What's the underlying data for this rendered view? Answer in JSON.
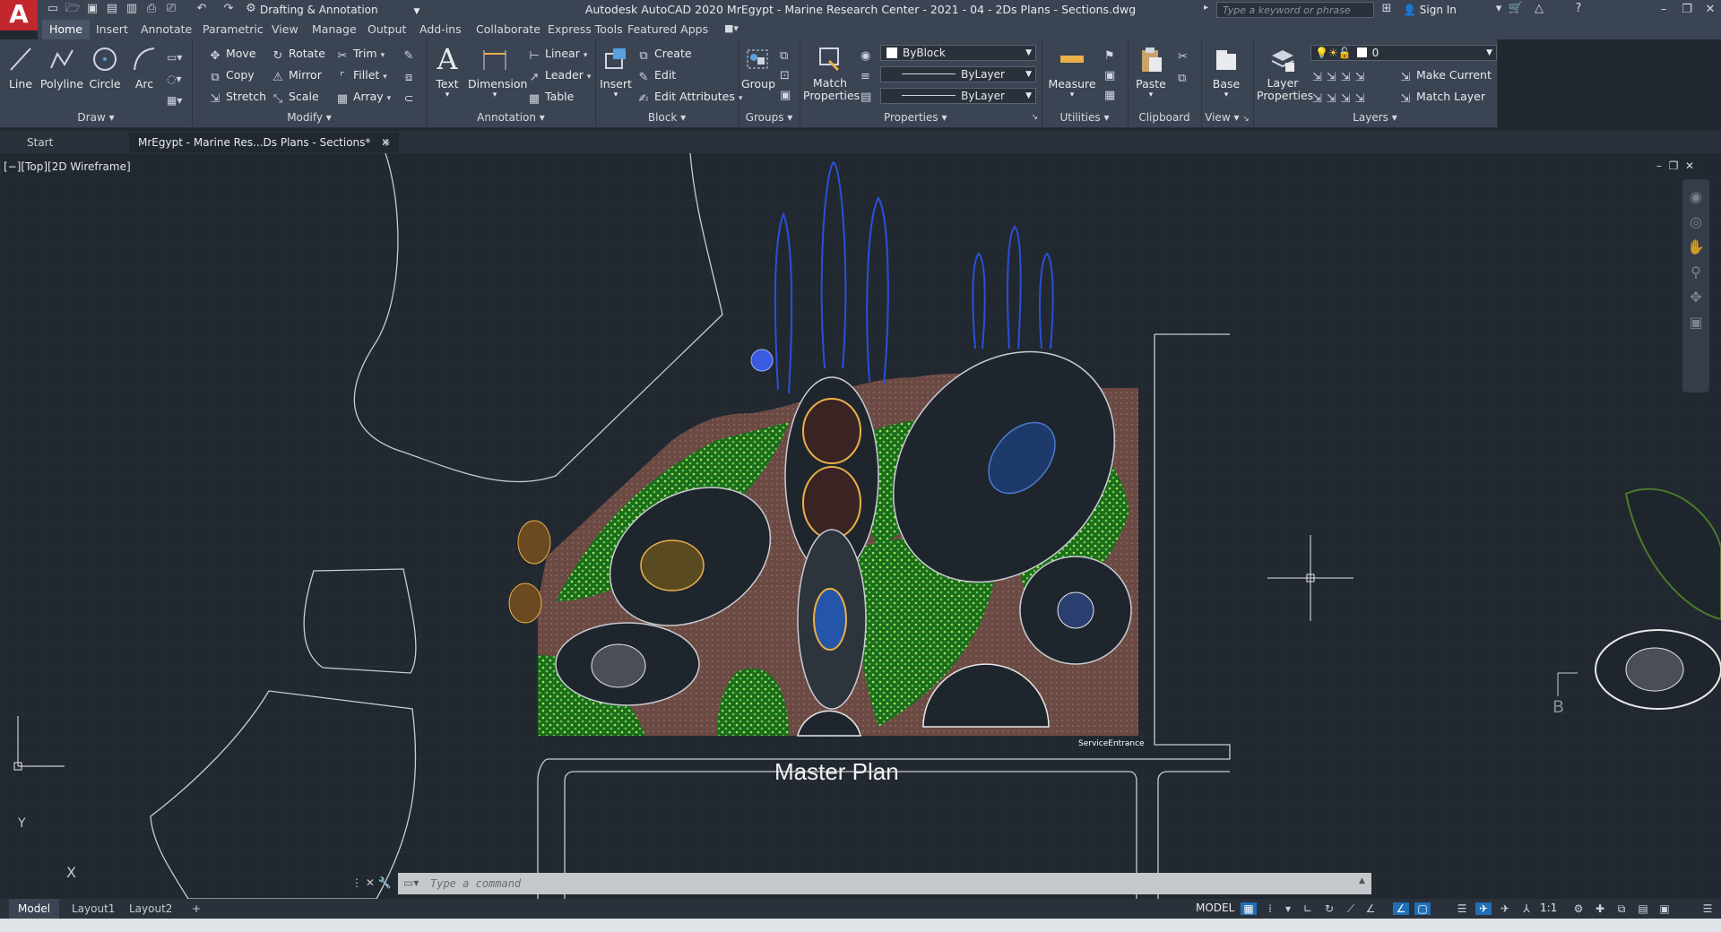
{
  "titlebar": {
    "app_letter": "A",
    "workspace": "Drafting & Annotation",
    "title": "Autodesk AutoCAD 2020   MrEgypt - Marine Research Center - 2021 - 04 - 2Ds Plans - Sections.dwg",
    "search_placeholder": "Type a keyword or phrase",
    "signin": "Sign In"
  },
  "menu_tabs": [
    "Home",
    "Insert",
    "Annotate",
    "Parametric",
    "View",
    "Manage",
    "Output",
    "Add-ins",
    "Collaborate",
    "Express Tools",
    "Featured Apps"
  ],
  "ribbon": {
    "draw": {
      "title": "Draw",
      "line": "Line",
      "polyline": "Polyline",
      "circle": "Circle",
      "arc": "Arc"
    },
    "modify": {
      "title": "Modify",
      "move": "Move",
      "rotate": "Rotate",
      "trim": "Trim",
      "copy": "Copy",
      "mirror": "Mirror",
      "fillet": "Fillet",
      "stretch": "Stretch",
      "scale": "Scale",
      "array": "Array"
    },
    "annotation": {
      "title": "Annotation",
      "text": "Text",
      "dimension": "Dimension",
      "linear": "Linear",
      "leader": "Leader",
      "table": "Table"
    },
    "block": {
      "title": "Block",
      "insert": "Insert",
      "create": "Create",
      "edit": "Edit",
      "edit_attributes": "Edit Attributes"
    },
    "groups": {
      "title": "Groups",
      "group": "Group"
    },
    "properties": {
      "title": "Properties",
      "match": "Match Properties",
      "color": "ByBlock",
      "linetype": "ByLayer",
      "lineweight": "ByLayer"
    },
    "utilities": {
      "title": "Utilities",
      "measure": "Measure"
    },
    "clipboard": {
      "title": "Clipboard",
      "paste": "Paste"
    },
    "view": {
      "title": "View",
      "base": "Base"
    },
    "layers": {
      "title": "Layers",
      "layer_properties": "Layer Properties",
      "current_layer": "0",
      "make_current": "Make Current",
      "match_layer": "Match Layer"
    }
  },
  "doc_tabs": {
    "start": "Start",
    "active": "MrEgypt - Marine Res...Ds Plans - Sections*"
  },
  "viewport": {
    "label": "[−][Top][2D Wireframe]",
    "drawing_title": "Master Plan",
    "service_entrance": "ServiceEntrance",
    "section_marker": "B",
    "ucs_x": "X",
    "ucs_y": "Y"
  },
  "command": {
    "placeholder": "Type a command"
  },
  "layout_tabs": [
    "Model",
    "Layout1",
    "Layout2"
  ],
  "status": {
    "model": "MODEL",
    "scale": "1:1"
  },
  "colors": {
    "accent": "#1f6fb8",
    "logo": "#c1272d",
    "canvas": "#212830",
    "ribbon": "#3b4453"
  }
}
